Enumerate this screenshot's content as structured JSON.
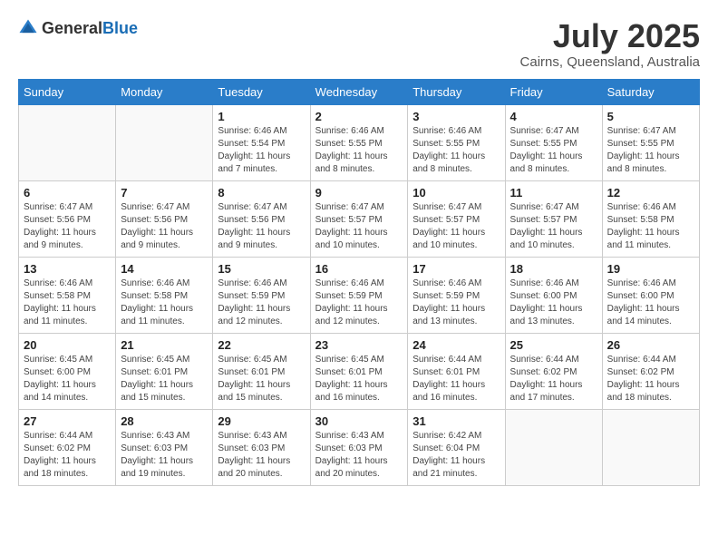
{
  "header": {
    "logo_general": "General",
    "logo_blue": "Blue",
    "month": "July 2025",
    "location": "Cairns, Queensland, Australia"
  },
  "days_of_week": [
    "Sunday",
    "Monday",
    "Tuesday",
    "Wednesday",
    "Thursday",
    "Friday",
    "Saturday"
  ],
  "weeks": [
    [
      {
        "day": "",
        "info": ""
      },
      {
        "day": "",
        "info": ""
      },
      {
        "day": "1",
        "info": "Sunrise: 6:46 AM\nSunset: 5:54 PM\nDaylight: 11 hours and 7 minutes."
      },
      {
        "day": "2",
        "info": "Sunrise: 6:46 AM\nSunset: 5:55 PM\nDaylight: 11 hours and 8 minutes."
      },
      {
        "day": "3",
        "info": "Sunrise: 6:46 AM\nSunset: 5:55 PM\nDaylight: 11 hours and 8 minutes."
      },
      {
        "day": "4",
        "info": "Sunrise: 6:47 AM\nSunset: 5:55 PM\nDaylight: 11 hours and 8 minutes."
      },
      {
        "day": "5",
        "info": "Sunrise: 6:47 AM\nSunset: 5:55 PM\nDaylight: 11 hours and 8 minutes."
      }
    ],
    [
      {
        "day": "6",
        "info": "Sunrise: 6:47 AM\nSunset: 5:56 PM\nDaylight: 11 hours and 9 minutes."
      },
      {
        "day": "7",
        "info": "Sunrise: 6:47 AM\nSunset: 5:56 PM\nDaylight: 11 hours and 9 minutes."
      },
      {
        "day": "8",
        "info": "Sunrise: 6:47 AM\nSunset: 5:56 PM\nDaylight: 11 hours and 9 minutes."
      },
      {
        "day": "9",
        "info": "Sunrise: 6:47 AM\nSunset: 5:57 PM\nDaylight: 11 hours and 10 minutes."
      },
      {
        "day": "10",
        "info": "Sunrise: 6:47 AM\nSunset: 5:57 PM\nDaylight: 11 hours and 10 minutes."
      },
      {
        "day": "11",
        "info": "Sunrise: 6:47 AM\nSunset: 5:57 PM\nDaylight: 11 hours and 10 minutes."
      },
      {
        "day": "12",
        "info": "Sunrise: 6:46 AM\nSunset: 5:58 PM\nDaylight: 11 hours and 11 minutes."
      }
    ],
    [
      {
        "day": "13",
        "info": "Sunrise: 6:46 AM\nSunset: 5:58 PM\nDaylight: 11 hours and 11 minutes."
      },
      {
        "day": "14",
        "info": "Sunrise: 6:46 AM\nSunset: 5:58 PM\nDaylight: 11 hours and 11 minutes."
      },
      {
        "day": "15",
        "info": "Sunrise: 6:46 AM\nSunset: 5:59 PM\nDaylight: 11 hours and 12 minutes."
      },
      {
        "day": "16",
        "info": "Sunrise: 6:46 AM\nSunset: 5:59 PM\nDaylight: 11 hours and 12 minutes."
      },
      {
        "day": "17",
        "info": "Sunrise: 6:46 AM\nSunset: 5:59 PM\nDaylight: 11 hours and 13 minutes."
      },
      {
        "day": "18",
        "info": "Sunrise: 6:46 AM\nSunset: 6:00 PM\nDaylight: 11 hours and 13 minutes."
      },
      {
        "day": "19",
        "info": "Sunrise: 6:46 AM\nSunset: 6:00 PM\nDaylight: 11 hours and 14 minutes."
      }
    ],
    [
      {
        "day": "20",
        "info": "Sunrise: 6:45 AM\nSunset: 6:00 PM\nDaylight: 11 hours and 14 minutes."
      },
      {
        "day": "21",
        "info": "Sunrise: 6:45 AM\nSunset: 6:01 PM\nDaylight: 11 hours and 15 minutes."
      },
      {
        "day": "22",
        "info": "Sunrise: 6:45 AM\nSunset: 6:01 PM\nDaylight: 11 hours and 15 minutes."
      },
      {
        "day": "23",
        "info": "Sunrise: 6:45 AM\nSunset: 6:01 PM\nDaylight: 11 hours and 16 minutes."
      },
      {
        "day": "24",
        "info": "Sunrise: 6:44 AM\nSunset: 6:01 PM\nDaylight: 11 hours and 16 minutes."
      },
      {
        "day": "25",
        "info": "Sunrise: 6:44 AM\nSunset: 6:02 PM\nDaylight: 11 hours and 17 minutes."
      },
      {
        "day": "26",
        "info": "Sunrise: 6:44 AM\nSunset: 6:02 PM\nDaylight: 11 hours and 18 minutes."
      }
    ],
    [
      {
        "day": "27",
        "info": "Sunrise: 6:44 AM\nSunset: 6:02 PM\nDaylight: 11 hours and 18 minutes."
      },
      {
        "day": "28",
        "info": "Sunrise: 6:43 AM\nSunset: 6:03 PM\nDaylight: 11 hours and 19 minutes."
      },
      {
        "day": "29",
        "info": "Sunrise: 6:43 AM\nSunset: 6:03 PM\nDaylight: 11 hours and 20 minutes."
      },
      {
        "day": "30",
        "info": "Sunrise: 6:43 AM\nSunset: 6:03 PM\nDaylight: 11 hours and 20 minutes."
      },
      {
        "day": "31",
        "info": "Sunrise: 6:42 AM\nSunset: 6:04 PM\nDaylight: 11 hours and 21 minutes."
      },
      {
        "day": "",
        "info": ""
      },
      {
        "day": "",
        "info": ""
      }
    ]
  ]
}
